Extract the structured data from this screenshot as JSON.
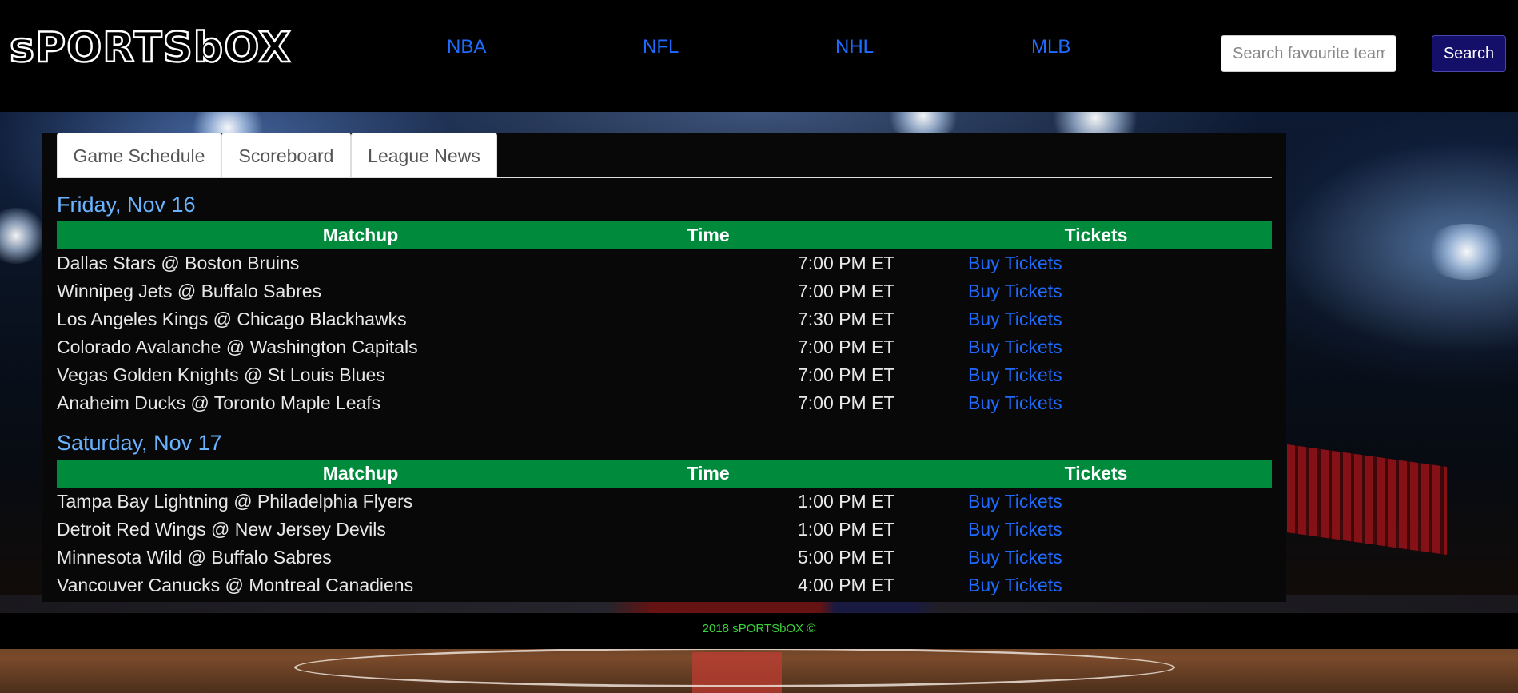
{
  "brand": {
    "logo_text": "sPORTSbOX"
  },
  "nav": {
    "items": [
      {
        "label": "NBA"
      },
      {
        "label": "NFL"
      },
      {
        "label": "NHL"
      },
      {
        "label": "MLB"
      }
    ]
  },
  "search": {
    "placeholder": "Search favourite team",
    "value": "",
    "button_label": "Search"
  },
  "tabs": [
    {
      "label": "Game Schedule",
      "active": true
    },
    {
      "label": "Scoreboard",
      "active": false
    },
    {
      "label": "League News",
      "active": false
    }
  ],
  "columns": {
    "matchup": "Matchup",
    "time": "Time",
    "tickets": "Tickets"
  },
  "schedule": [
    {
      "day": "Friday, Nov 16",
      "games": [
        {
          "matchup": "Dallas Stars @ Boston Bruins",
          "time": "7:00 PM ET",
          "tickets": "Buy Tickets"
        },
        {
          "matchup": "Winnipeg Jets @ Buffalo Sabres",
          "time": "7:00 PM ET",
          "tickets": "Buy Tickets"
        },
        {
          "matchup": "Los Angeles Kings @ Chicago Blackhawks",
          "time": "7:30 PM ET",
          "tickets": "Buy Tickets"
        },
        {
          "matchup": "Colorado Avalanche @ Washington Capitals",
          "time": "7:00 PM ET",
          "tickets": "Buy Tickets"
        },
        {
          "matchup": "Vegas Golden Knights @ St Louis Blues",
          "time": "7:00 PM ET",
          "tickets": "Buy Tickets"
        },
        {
          "matchup": "Anaheim Ducks @ Toronto Maple Leafs",
          "time": "7:00 PM ET",
          "tickets": "Buy Tickets"
        }
      ]
    },
    {
      "day": "Saturday, Nov 17",
      "games": [
        {
          "matchup": "Tampa Bay Lightning @ Philadelphia Flyers",
          "time": "1:00 PM ET",
          "tickets": "Buy Tickets"
        },
        {
          "matchup": "Detroit Red Wings @ New Jersey Devils",
          "time": "1:00 PM ET",
          "tickets": "Buy Tickets"
        },
        {
          "matchup": "Minnesota Wild @ Buffalo Sabres",
          "time": "5:00 PM ET",
          "tickets": "Buy Tickets"
        },
        {
          "matchup": "Vancouver Canucks @ Montreal Canadiens",
          "time": "4:00 PM ET",
          "tickets": "Buy Tickets"
        }
      ]
    }
  ],
  "footer": {
    "text": "2018 sPORTSbOX ©"
  },
  "colors": {
    "nav_link": "#1f6bff",
    "table_header": "#008a3c",
    "day_title": "#69b3ff",
    "search_button": "#14106a",
    "footer_text": "#3ad33a"
  }
}
